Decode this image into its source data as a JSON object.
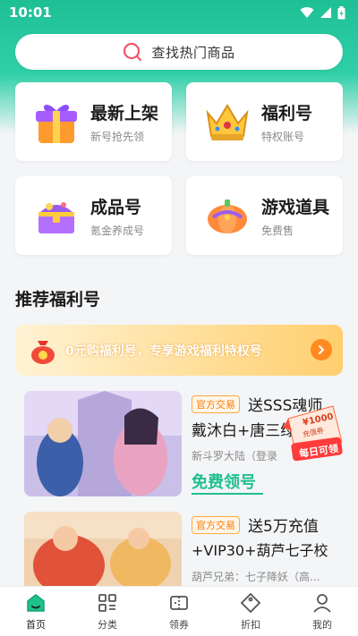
{
  "status_bar": {
    "time": "10:01"
  },
  "search": {
    "placeholder": "查找热门商品"
  },
  "categories": [
    {
      "title": "最新上架",
      "subtitle": "新号抢先领",
      "icon": "gift-box-icon"
    },
    {
      "title": "福利号",
      "subtitle": "特权账号",
      "icon": "crown-icon"
    },
    {
      "title": "成品号",
      "subtitle": "氪金养成号",
      "icon": "treasure-chest-icon"
    },
    {
      "title": "游戏道具",
      "subtitle": "免费售",
      "icon": "pumpkin-icon"
    }
  ],
  "section": {
    "title": "推荐福利号"
  },
  "banner": {
    "text": "0元购福利号，专享游戏福利特权号"
  },
  "items": [
    {
      "tag": "官方交易",
      "title_line1": "送SSS魂师",
      "title_line2": "戴沐白+唐三绿",
      "meta": "新斗罗大陆（登录",
      "action": "免费领号"
    },
    {
      "tag": "官方交易",
      "title_line1": "送5万充值",
      "title_line2": "+VIP30+葫芦七子校",
      "meta": "葫芦兄弟：七子降妖（高..."
    }
  ],
  "sticker": {
    "line1": "¥1000",
    "line2": "充值券",
    "line3": "每日可领"
  },
  "tabbar": [
    {
      "label": "首页",
      "icon": "home-icon",
      "active": true
    },
    {
      "label": "分类",
      "icon": "grid-icon"
    },
    {
      "label": "领券",
      "icon": "ticket-icon"
    },
    {
      "label": "折扣",
      "icon": "tag-icon"
    },
    {
      "label": "我的",
      "icon": "person-icon"
    }
  ],
  "colors": {
    "accent": "#1ec08c",
    "tag": "#ff7b00",
    "banner": "#ffcf6e"
  }
}
